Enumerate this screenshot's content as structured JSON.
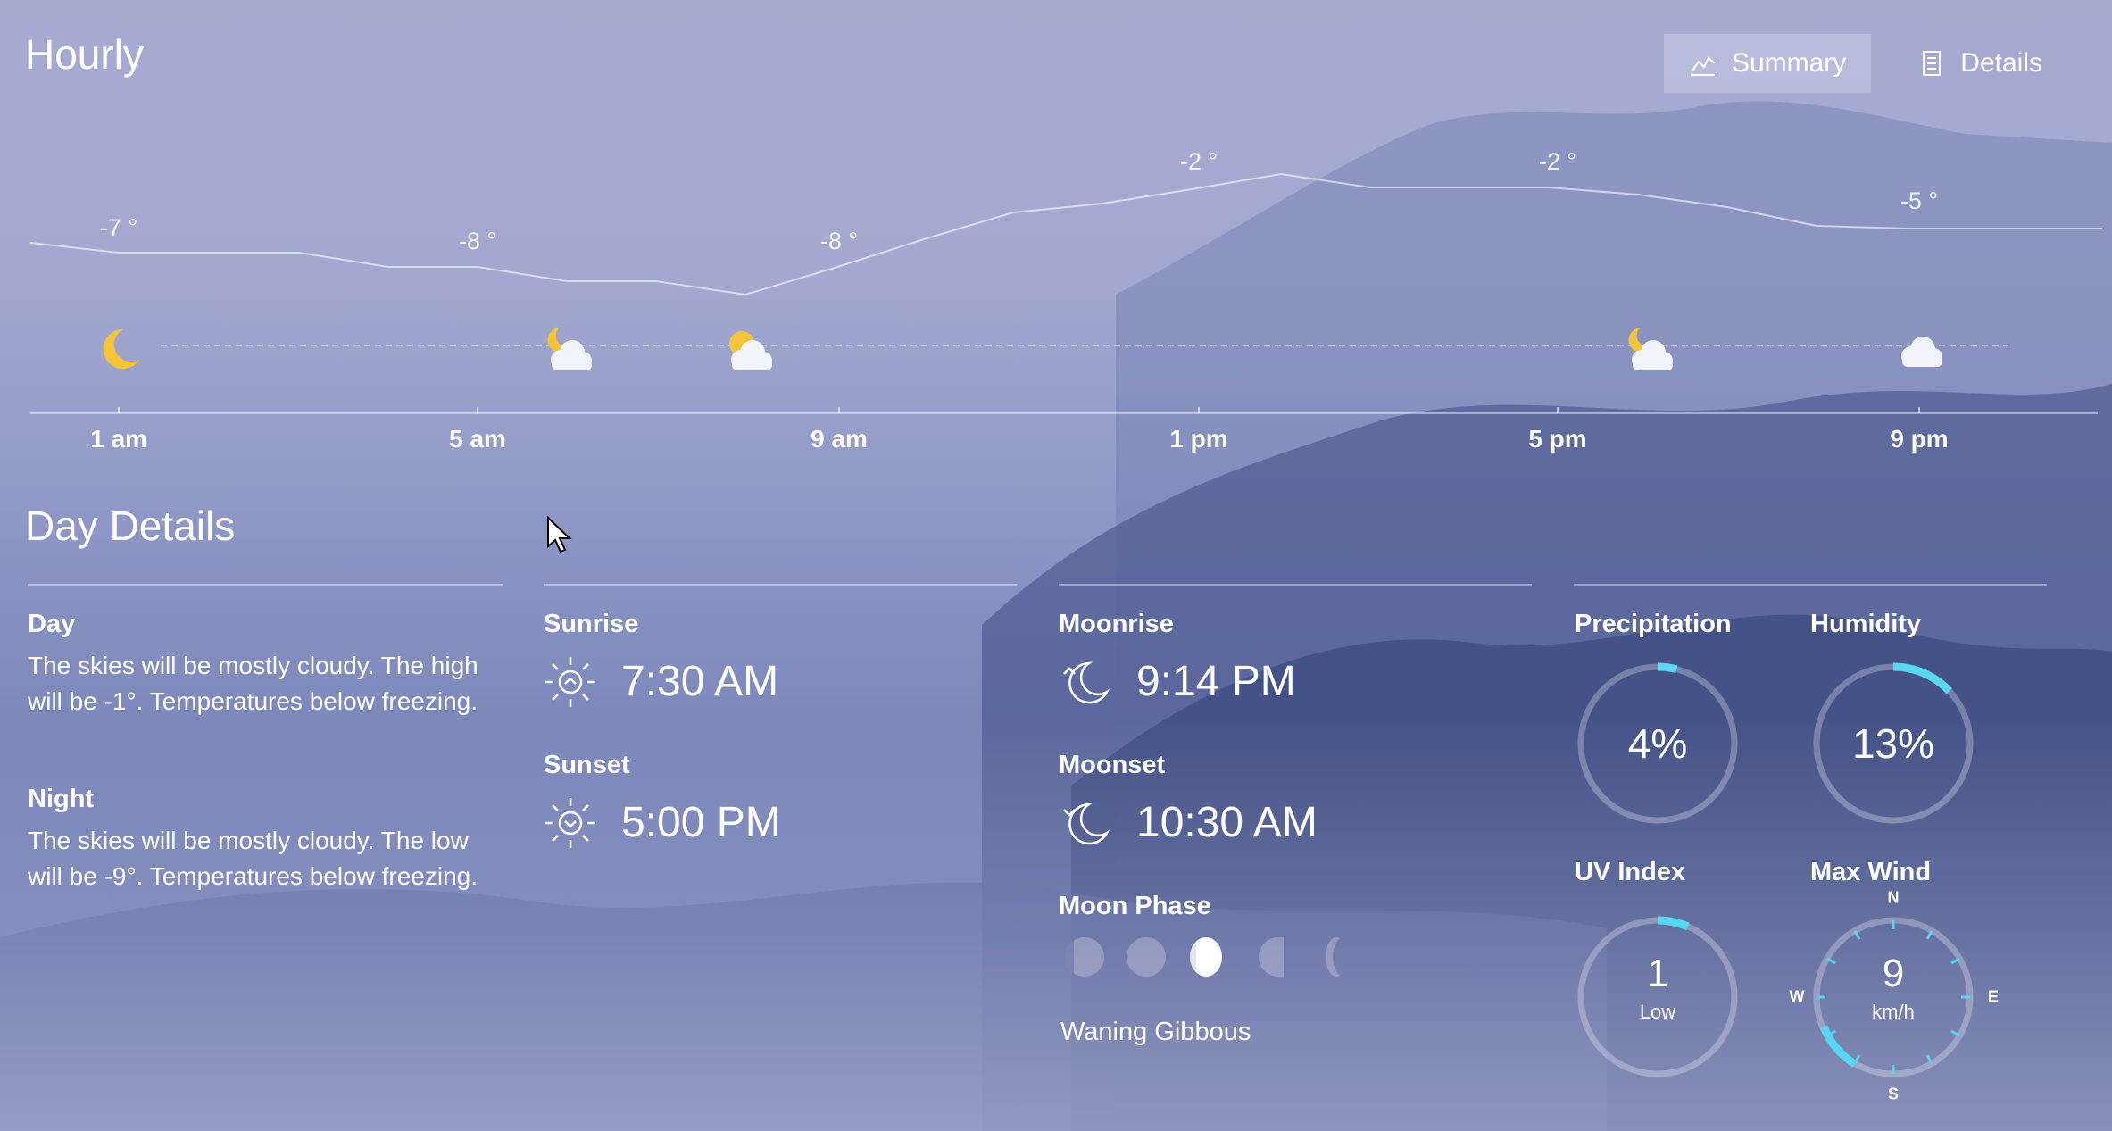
{
  "hourly": {
    "title": "Hourly",
    "tabs": [
      {
        "label": "Summary",
        "icon": "chart-icon",
        "active": true
      },
      {
        "label": "Details",
        "icon": "details-icon",
        "active": false
      }
    ],
    "temps": [
      "-7 °",
      "-8 °",
      "-8 °",
      "-2 °",
      "-2 °",
      "-5 °"
    ],
    "times": [
      "1 am",
      "5 am",
      "9 am",
      "1 pm",
      "5 pm",
      "9 pm"
    ],
    "conditions": [
      "moon-icon",
      "partly-cloudy-night-icon",
      "partly-cloudy-icon",
      "partly-cloudy-night-icon",
      "cloud-icon"
    ]
  },
  "day_details": {
    "title": "Day Details",
    "day_label": "Day",
    "day_text": "The skies will be mostly cloudy. The high will be -1°. Temperatures below freezing.",
    "night_label": "Night",
    "night_text": "The skies will be mostly cloudy. The low will be -9°. Temperatures below freezing.",
    "sunrise_label": "Sunrise",
    "sunrise": "7:30 AM",
    "sunset_label": "Sunset",
    "sunset": "5:00 PM",
    "moonrise_label": "Moonrise",
    "moonrise": "9:14 PM",
    "moonset_label": "Moonset",
    "moonset": "10:30 AM",
    "moon_phase_label": "Moon Phase",
    "moon_phase": "Waning Gibbous",
    "precipitation_label": "Precipitation",
    "precipitation": "4%",
    "precipitation_fraction": 0.04,
    "humidity_label": "Humidity",
    "humidity": "13%",
    "humidity_fraction": 0.13,
    "uv_label": "UV Index",
    "uv_value": "1",
    "uv_desc": "Low",
    "wind_label": "Max Wind",
    "wind_value": "9",
    "wind_unit": "km/h",
    "compass": {
      "n": "N",
      "e": "E",
      "s": "S",
      "w": "W"
    }
  },
  "colors": {
    "accent": "#59d6f2"
  }
}
